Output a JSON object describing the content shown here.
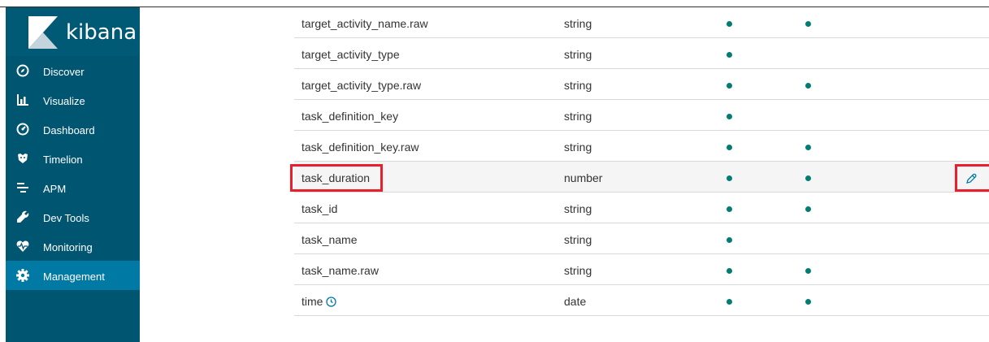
{
  "brand": {
    "name": "kibana"
  },
  "sidebar": {
    "items": [
      {
        "label": "Discover",
        "icon": "compass-icon",
        "active": false
      },
      {
        "label": "Visualize",
        "icon": "bar-chart-icon",
        "active": false
      },
      {
        "label": "Dashboard",
        "icon": "gauge-icon",
        "active": false
      },
      {
        "label": "Timelion",
        "icon": "timelion-icon",
        "active": false
      },
      {
        "label": "APM",
        "icon": "apm-icon",
        "active": false
      },
      {
        "label": "Dev Tools",
        "icon": "wrench-icon",
        "active": false
      },
      {
        "label": "Monitoring",
        "icon": "heartbeat-icon",
        "active": false
      },
      {
        "label": "Management",
        "icon": "gear-icon",
        "active": true
      }
    ]
  },
  "fields": [
    {
      "name": "target_activity_name.raw",
      "type": "string",
      "searchable": true,
      "aggregatable": true
    },
    {
      "name": "target_activity_type",
      "type": "string",
      "searchable": true,
      "aggregatable": false
    },
    {
      "name": "target_activity_type.raw",
      "type": "string",
      "searchable": true,
      "aggregatable": true
    },
    {
      "name": "task_definition_key",
      "type": "string",
      "searchable": true,
      "aggregatable": false
    },
    {
      "name": "task_definition_key.raw",
      "type": "string",
      "searchable": true,
      "aggregatable": true
    },
    {
      "name": "task_duration",
      "type": "number",
      "searchable": true,
      "aggregatable": true,
      "highlighted": true
    },
    {
      "name": "task_id",
      "type": "string",
      "searchable": true,
      "aggregatable": true
    },
    {
      "name": "task_name",
      "type": "string",
      "searchable": true,
      "aggregatable": false
    },
    {
      "name": "task_name.raw",
      "type": "string",
      "searchable": true,
      "aggregatable": true
    },
    {
      "name": "time",
      "type": "date",
      "searchable": true,
      "aggregatable": true,
      "time_field": true
    }
  ],
  "colors": {
    "sidebar_bg": "#005571",
    "active_item": "#0079a5",
    "dot": "#017d73",
    "highlight": "#e8202e",
    "link_blue": "#0079a5"
  }
}
